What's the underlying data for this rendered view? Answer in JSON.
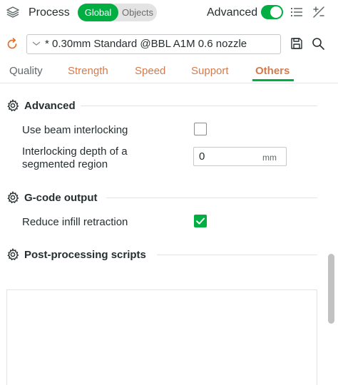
{
  "header": {
    "title": "Process",
    "scope_options": {
      "global": "Global",
      "objects": "Objects"
    },
    "selected_scope": "Global",
    "advanced_label": "Advanced",
    "advanced_enabled": true
  },
  "preset": {
    "name": "* 0.30mm Standard @BBL A1M 0.6 nozzle"
  },
  "tabs": [
    {
      "label": "Quality"
    },
    {
      "label": "Strength"
    },
    {
      "label": "Speed"
    },
    {
      "label": "Support"
    },
    {
      "label": "Others",
      "active": true
    }
  ],
  "sections": {
    "advanced": {
      "title": "Advanced",
      "beam_interlocking": {
        "label": "Use beam interlocking",
        "checked": false
      },
      "interlocking_depth": {
        "label_line1": "Interlocking depth of a",
        "label_line2": "segmented region",
        "value": "0",
        "unit": "mm"
      }
    },
    "gcode_output": {
      "title": "G-code output",
      "reduce_infill_retraction": {
        "label": "Reduce infill retraction",
        "checked": true
      }
    },
    "post_processing": {
      "title": "Post-processing scripts",
      "scripts": ""
    }
  },
  "colors": {
    "accent": "#00ae42",
    "tab_inactive": "#d47b4d",
    "text": "#262e30"
  }
}
